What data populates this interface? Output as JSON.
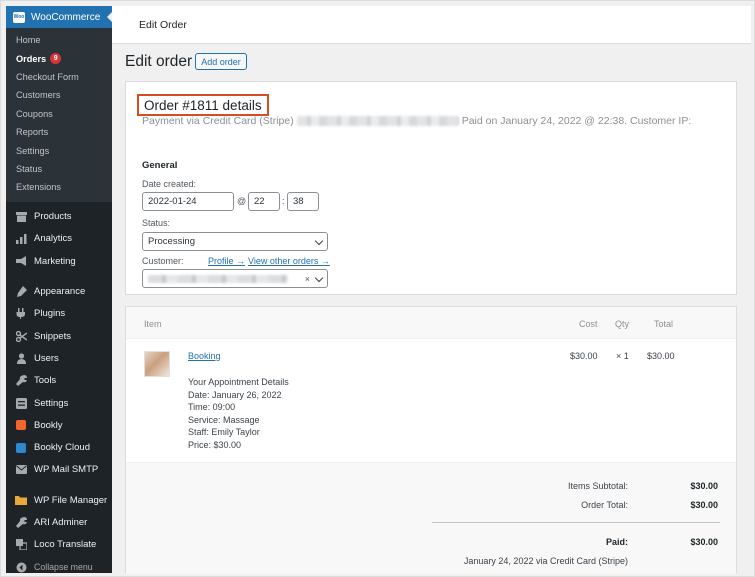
{
  "topbar": {
    "title": "Edit Order"
  },
  "sidebar": {
    "brand": "WooCommerce",
    "brand_logo_text": "Woo",
    "woo_submenu": [
      {
        "label": "Home"
      },
      {
        "label": "Orders",
        "badge": "9",
        "current": true
      },
      {
        "label": "Checkout Form"
      },
      {
        "label": "Customers"
      },
      {
        "label": "Coupons"
      },
      {
        "label": "Reports"
      },
      {
        "label": "Settings"
      },
      {
        "label": "Status"
      },
      {
        "label": "Extensions"
      }
    ],
    "menu": [
      {
        "label": "Products",
        "icon": "products-icon"
      },
      {
        "label": "Analytics",
        "icon": "analytics-icon"
      },
      {
        "label": "Marketing",
        "icon": "marketing-icon"
      },
      {
        "label": "Appearance",
        "icon": "appearance-icon"
      },
      {
        "label": "Plugins",
        "icon": "plugins-icon"
      },
      {
        "label": "Snippets",
        "icon": "snippets-icon"
      },
      {
        "label": "Users",
        "icon": "users-icon"
      },
      {
        "label": "Tools",
        "icon": "tools-icon"
      },
      {
        "label": "Settings",
        "icon": "settings-icon"
      },
      {
        "label": "Bookly",
        "icon": "bookly-icon"
      },
      {
        "label": "Bookly Cloud",
        "icon": "bookly-cloud-icon"
      },
      {
        "label": "WP Mail SMTP",
        "icon": "mail-icon"
      },
      {
        "label": "WP File Manager",
        "icon": "file-manager-icon"
      },
      {
        "label": "ARI Adminer",
        "icon": "adminer-icon"
      },
      {
        "label": "Loco Translate",
        "icon": "translate-icon"
      },
      {
        "label": "Collapse menu",
        "icon": "collapse-icon"
      }
    ]
  },
  "page": {
    "title": "Edit order",
    "add_button": "Add order"
  },
  "order": {
    "heading": "Order #1811 details",
    "payment_prefix": "Payment via Credit Card (Stripe)",
    "payment_suffix": "Paid on January 24, 2022 @ 22:38. Customer IP:",
    "general_heading": "General",
    "date_created_label": "Date created:",
    "date": "2022-01-24",
    "at_sign": "@",
    "hour": "22",
    "colon": ":",
    "minute": "38",
    "status_label": "Status:",
    "status_value": "Processing",
    "customer_label": "Customer:",
    "profile_link": "Profile →",
    "other_orders_link": "View other orders →",
    "clear_symbol": "×"
  },
  "items": {
    "headers": {
      "item": "Item",
      "cost": "Cost",
      "qty": "Qty",
      "total": "Total"
    },
    "rows": [
      {
        "name": "Booking",
        "cost": "$30.00",
        "qty": "× 1",
        "total": "$30.00",
        "meta": [
          "Your Appointment Details",
          "Date: January 26, 2022",
          "Time: 09:00",
          "Service: Massage",
          "Staff: Emily Taylor",
          "Price: $30.00"
        ]
      }
    ],
    "totals": {
      "subtotal_label": "Items Subtotal:",
      "subtotal_value": "$30.00",
      "order_total_label": "Order Total:",
      "order_total_value": "$30.00",
      "paid_label": "Paid:",
      "paid_value": "$30.00",
      "paid_note": "January 24, 2022 via Credit Card (Stripe)"
    }
  },
  "colors": {
    "accent": "#2271b1",
    "sidebar": "#1d2327",
    "highlight_box": "#d54e21",
    "badge": "#d63638"
  }
}
